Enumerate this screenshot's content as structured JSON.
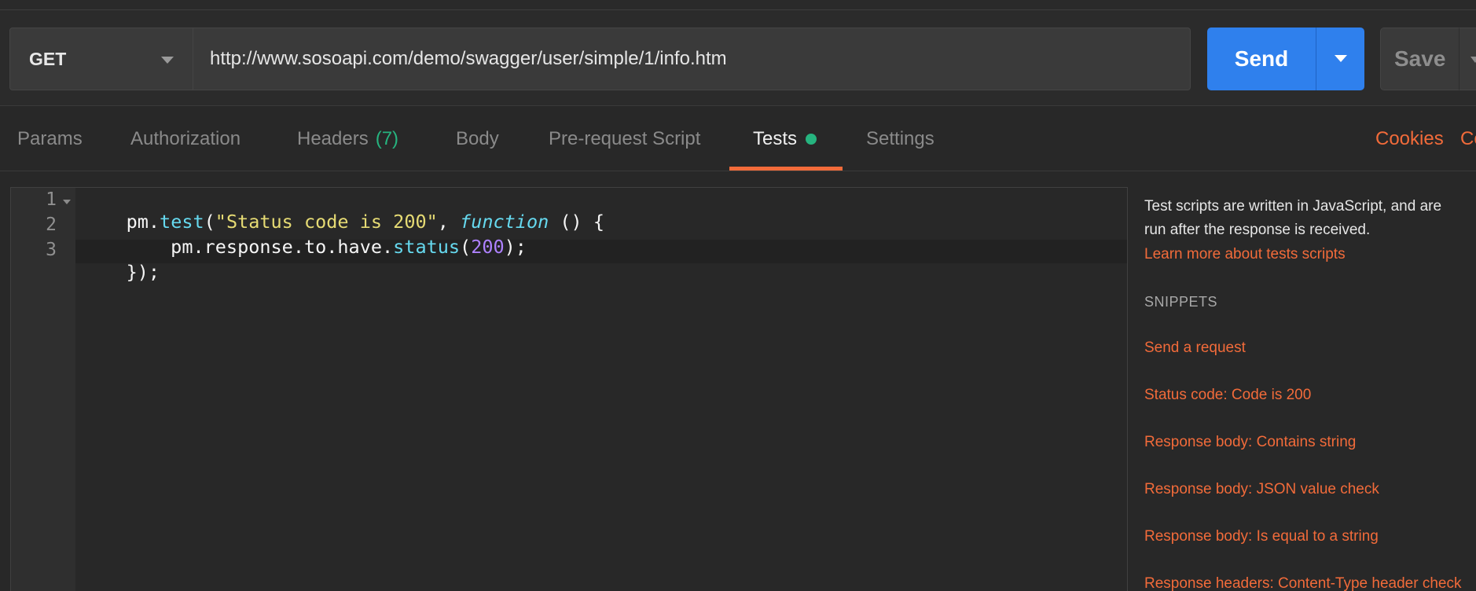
{
  "request": {
    "method": "GET",
    "url": "http://www.sosoapi.com/demo/swagger/user/simple/1/info.htm",
    "send_label": "Send",
    "save_label": "Save"
  },
  "tabs": [
    {
      "label": "Params"
    },
    {
      "label": "Authorization"
    },
    {
      "label": "Headers",
      "count": "(7)"
    },
    {
      "label": "Body"
    },
    {
      "label": "Pre-request Script"
    },
    {
      "label": "Tests",
      "active": true,
      "indicator": "green-dot"
    },
    {
      "label": "Settings"
    }
  ],
  "right_links": {
    "cookies": "Cookies",
    "code_partial": "Co"
  },
  "editor": {
    "line_numbers": [
      "1",
      "2",
      "3"
    ],
    "lines": [
      {
        "t1": "pm.",
        "t2": "test",
        "t3": "(",
        "t4": "\"Status code is 200\"",
        "t5": ", ",
        "t6": "function",
        "t7": " () {"
      },
      {
        "t1": "    pm.response.to.have.",
        "t2": "status",
        "t3": "(",
        "t4": "200",
        "t5": ");"
      },
      {
        "t1": "});"
      }
    ]
  },
  "side_panel": {
    "desc_line1": "Test scripts are written in JavaScript, and are",
    "desc_line2": "run after the response is received.",
    "learn_more": "Learn more about tests scripts",
    "snippets_heading": "SNIPPETS",
    "snippets": [
      "Send a request",
      "Status code: Code is 200",
      "Response body: Contains string",
      "Response body: JSON value check",
      "Response body: Is equal to a string",
      "Response headers: Content-Type header check"
    ]
  },
  "colors": {
    "accent": "#f26b3a",
    "primary": "#2f80ed",
    "success": "#26b47f",
    "background": "#282828"
  }
}
